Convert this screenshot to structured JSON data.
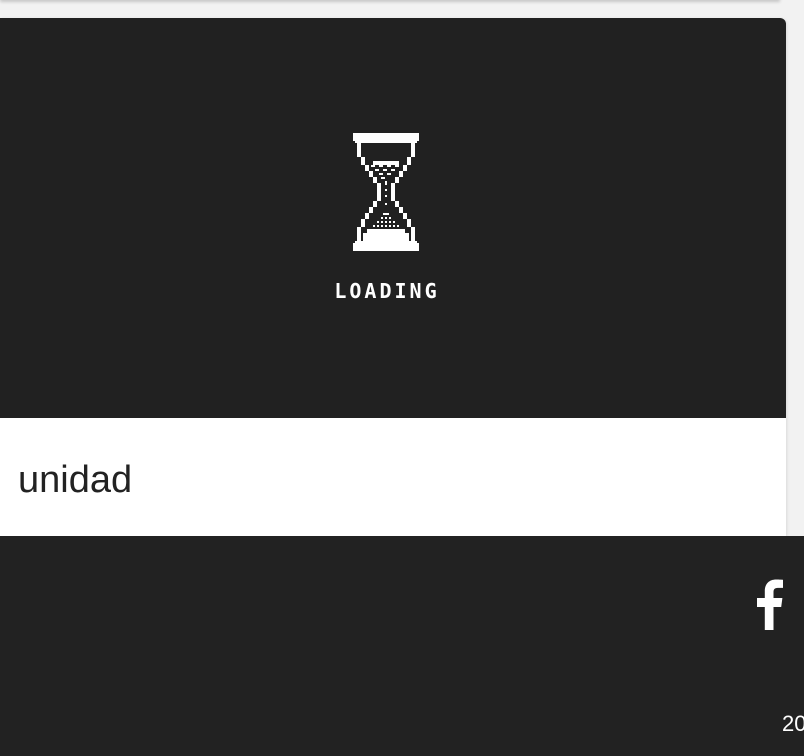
{
  "card": {
    "loading_label": "LOADING",
    "title": "unidad"
  },
  "footer": {
    "social_icon": "facebook-icon",
    "copyright_text": "20"
  },
  "colors": {
    "media_background": "#212121",
    "footer_background": "#222222",
    "text_dark": "#222222",
    "text_light": "#ffffff"
  }
}
